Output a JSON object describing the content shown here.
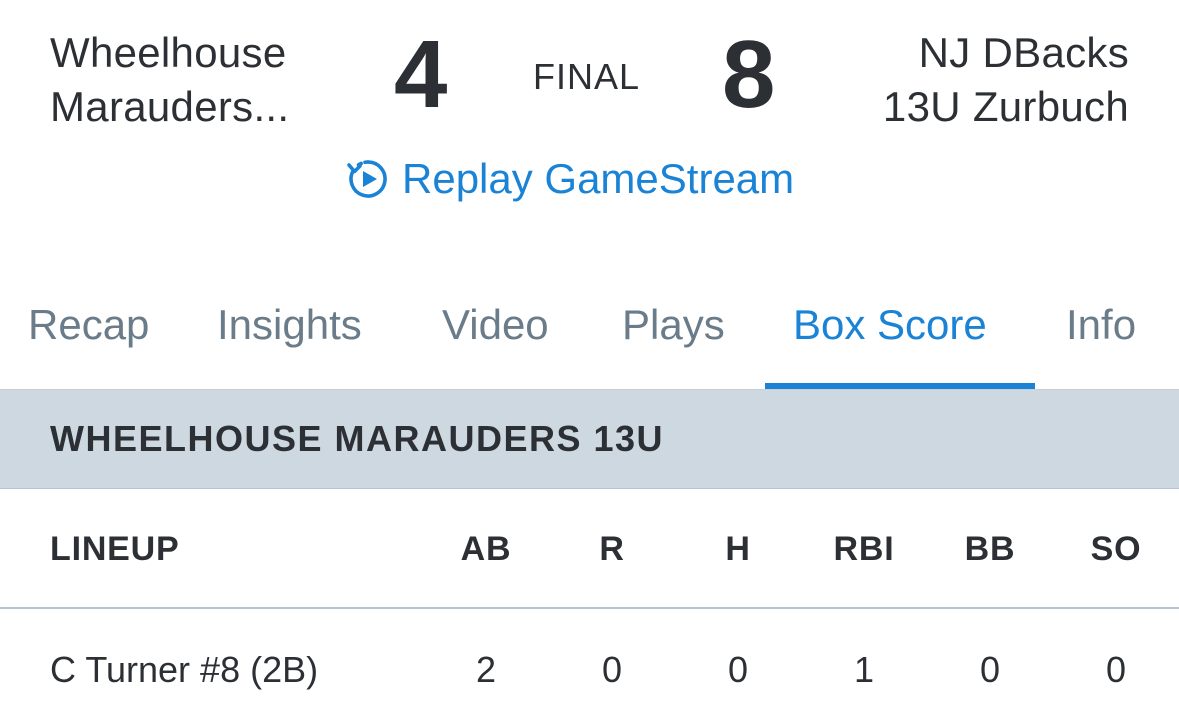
{
  "scoreboard": {
    "away_team_line1": "Wheelhouse",
    "away_team_line2": "Marauders...",
    "away_score": "4",
    "status": "FINAL",
    "home_score": "8",
    "home_team_line1": "NJ DBacks",
    "home_team_line2": "13U Zurbuch",
    "replay_label": "Replay GameStream"
  },
  "tabs": [
    {
      "label": "Recap",
      "active": false
    },
    {
      "label": "Insights",
      "active": false
    },
    {
      "label": "Video",
      "active": false
    },
    {
      "label": "Plays",
      "active": false
    },
    {
      "label": "Box Score",
      "active": true
    },
    {
      "label": "Info",
      "active": false
    }
  ],
  "box_score": {
    "team_name": "WHEELHOUSE MARAUDERS 13U",
    "columns": [
      "LINEUP",
      "AB",
      "R",
      "H",
      "RBI",
      "BB",
      "SO"
    ],
    "rows": [
      {
        "player": "C Turner #8 (2B)",
        "stats": [
          "2",
          "0",
          "0",
          "1",
          "0",
          "0"
        ]
      }
    ]
  },
  "colors": {
    "accent": "#1a83d6",
    "text": "#2c3035",
    "tab_inactive": "#6a7b89",
    "section_bg": "#cdd8e0"
  },
  "icons": {
    "replay": "replay-circle-play-icon"
  }
}
